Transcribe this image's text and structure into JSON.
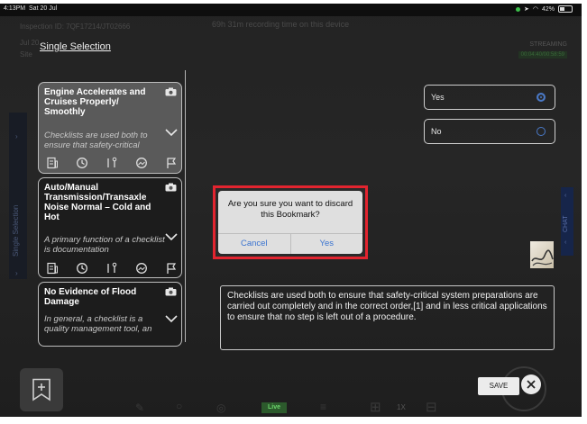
{
  "status": {
    "time": "4:13PM",
    "date": "Sat 20 Jul",
    "battery": "42%"
  },
  "header": {
    "inspection_id": "Inspection ID: 7QF17214/JT02666",
    "recording_info": "69h 31m recording time on this device",
    "date_line": "Jul 20",
    "site_line": "Site",
    "streaming_label": "STREAMING",
    "stream_time": "00:04:40/00:58:59"
  },
  "panel": {
    "title": "Single Selection",
    "side_tab_label": "Single Selection",
    "chat_tab_label": "CHAT"
  },
  "cards": [
    {
      "title": "Engine Accelerates and Cruises Properly/ Smoothly",
      "description": "Checklists are used both to ensure that safety-critical"
    },
    {
      "title": "Auto/Manual Transmission/Transaxle Noise Normal – Cold and Hot",
      "description": "A primary function of a checklist is documentation"
    },
    {
      "title": "No Evidence of Flood Damage",
      "description": "In general, a checklist is a quality management tool, an"
    }
  ],
  "options": [
    {
      "label": "Yes",
      "selected": true
    },
    {
      "label": "No",
      "selected": false
    }
  ],
  "notes_text": "Checklists are used both to ensure that safety-critical system preparations are carried out completely and in the correct order,[1] and in less critical applications to ensure that no step is left out of a procedure.",
  "dialog": {
    "message": "Are you sure you want to discard this Bookmark?",
    "cancel_label": "Cancel",
    "confirm_label": "Yes"
  },
  "toolbar": {
    "live_label": "Live",
    "zoom_label": "1X",
    "save_label": "SAVE"
  },
  "colors": {
    "accent_blue": "#3b74d0",
    "dialog_border": "#e2242f",
    "live_green": "#2c5a2c"
  }
}
